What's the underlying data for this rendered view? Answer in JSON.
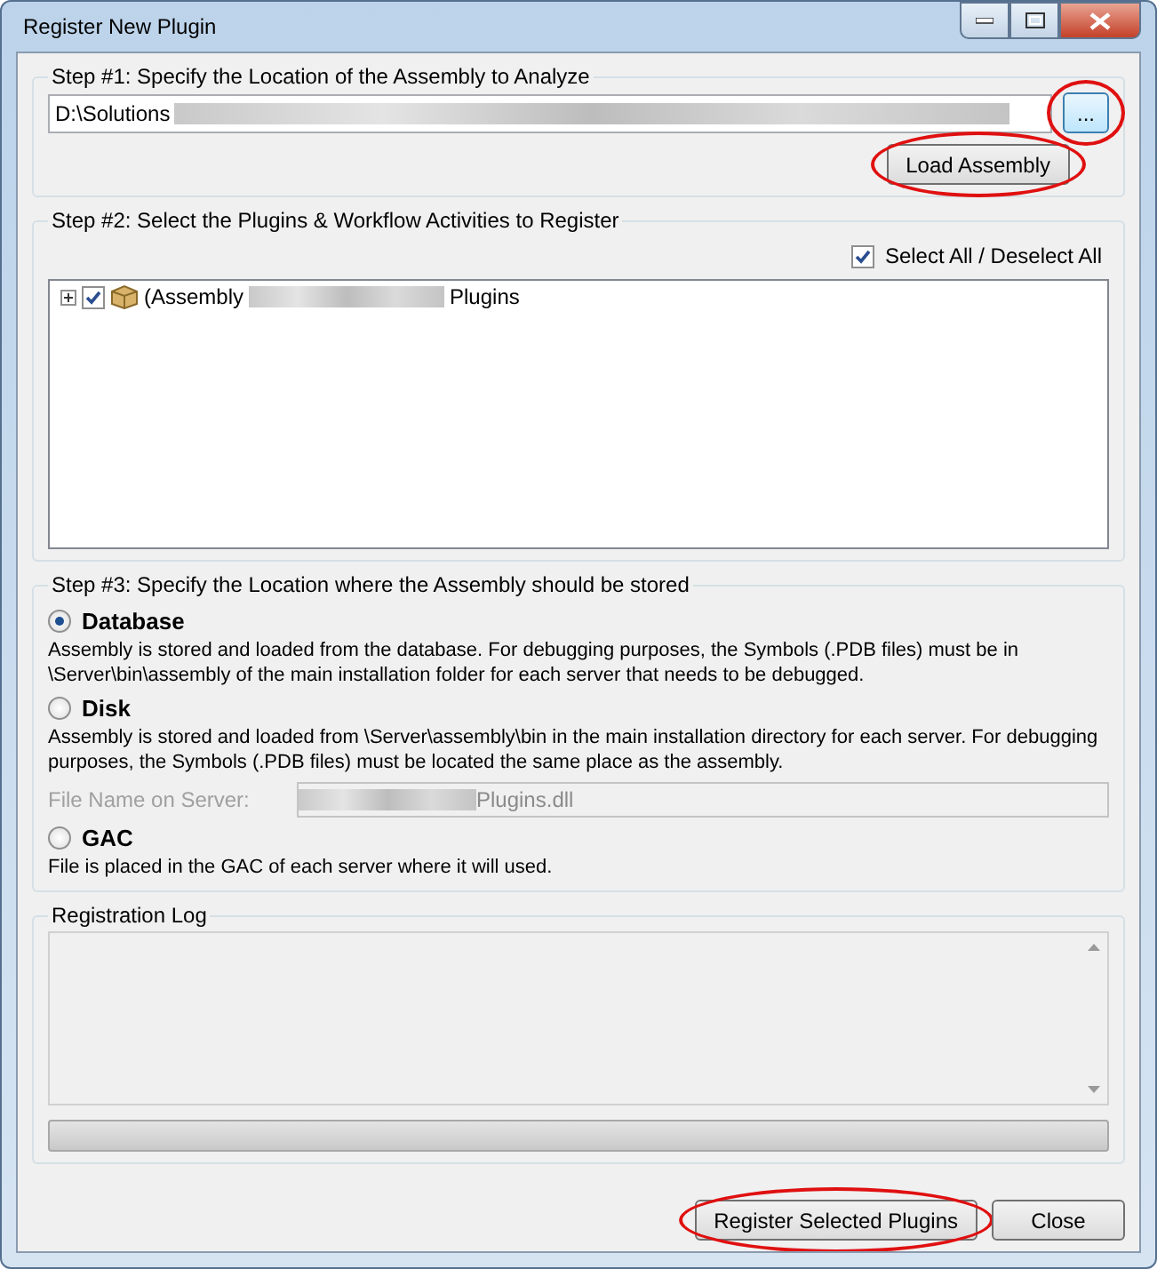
{
  "window": {
    "title": "Register New Plugin"
  },
  "step1": {
    "title": "Step #1: Specify the Location of the Assembly to Analyze",
    "path": "D:\\Solutions",
    "browse_button": {
      "label": "...",
      "annotated": true
    },
    "load_button": {
      "label": "Load Assembly",
      "annotated": true
    }
  },
  "step2": {
    "title": "Step #2: Select the Plugins & Workflow Activities to Register",
    "select_all": {
      "label": "Select All / Deselect All",
      "checked": true
    },
    "tree": [
      {
        "label_start": "(Assembly",
        "label_end": "Plugins",
        "checked": true,
        "expanded": false
      }
    ]
  },
  "step3": {
    "title": "Step #3: Specify the Location where the Assembly should be stored",
    "options": [
      {
        "label": "Database",
        "selected": true,
        "description": "Assembly is stored and loaded from the database. For debugging purposes, the Symbols (.PDB files) must be in \\Server\\bin\\assembly of the main installation folder for each server that needs to be debugged."
      },
      {
        "label": "Disk",
        "selected": false,
        "description": "Assembly is stored and loaded from \\Server\\assembly\\bin in the main installation directory for each server. For debugging purposes, the Symbols (.PDB files) must be located the same place as the assembly.",
        "file_name": {
          "label": "File Name on Server:",
          "value": "Plugins.dll",
          "disabled": true
        }
      },
      {
        "label": "GAC",
        "selected": false,
        "description": "File is placed in the GAC of each server where it will used."
      }
    ]
  },
  "log": {
    "title": "Registration Log",
    "level": 0
  },
  "buttons": [
    {
      "label": "Register Selected Plugins",
      "annotated": true
    },
    {
      "label": "Close",
      "annotated": false
    }
  ]
}
